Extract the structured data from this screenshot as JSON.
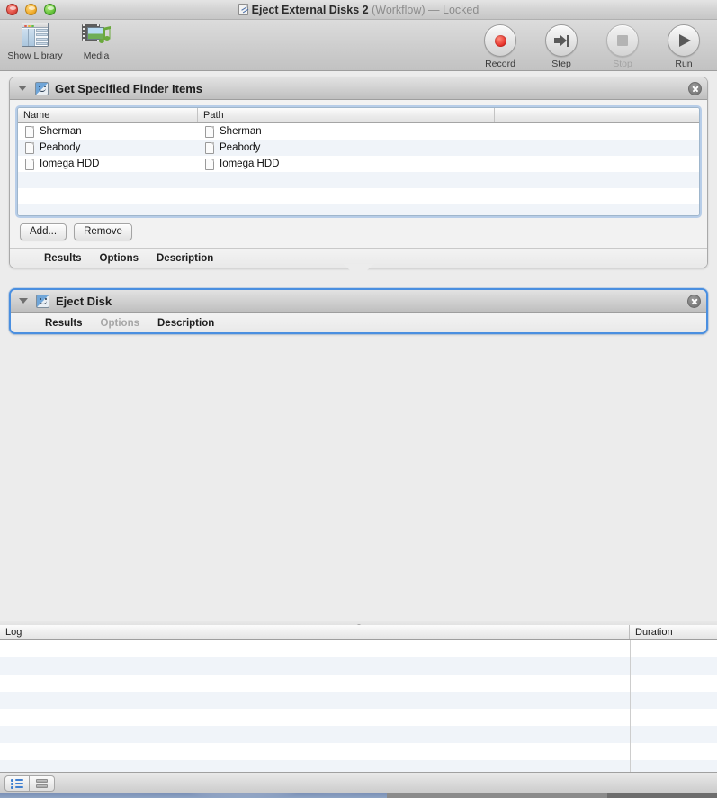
{
  "window": {
    "title_name": "Eject External Disks 2",
    "title_suffix": "(Workflow) — Locked",
    "traffic_lights": [
      "close-button",
      "minimize-button",
      "zoom-button"
    ]
  },
  "toolbar": {
    "left_items": [
      {
        "label": "Show Library",
        "icon": "library-icon",
        "enabled": true
      },
      {
        "label": "Media",
        "icon": "media-icon",
        "enabled": true
      }
    ],
    "right_items": [
      {
        "label": "Record",
        "icon": "record-icon",
        "enabled": true
      },
      {
        "label": "Step",
        "icon": "step-icon",
        "enabled": true
      },
      {
        "label": "Stop",
        "icon": "stop-icon",
        "enabled": false
      },
      {
        "label": "Run",
        "icon": "run-icon",
        "enabled": true
      }
    ]
  },
  "workflow": {
    "actions": [
      {
        "title": "Get Specified Finder Items",
        "icon": "finder-icon",
        "selected": false,
        "table": {
          "columns": [
            "Name",
            "Path"
          ],
          "rows": [
            {
              "name": "Sherman",
              "path": "Sherman"
            },
            {
              "name": "Peabody",
              "path": "Peabody"
            },
            {
              "name": "Iomega HDD",
              "path": "Iomega HDD"
            }
          ]
        },
        "buttons": [
          {
            "label": "Add...",
            "name": "add-button"
          },
          {
            "label": "Remove",
            "name": "remove-button"
          }
        ],
        "footer_tabs": [
          {
            "label": "Results",
            "enabled": true
          },
          {
            "label": "Options",
            "enabled": true
          },
          {
            "label": "Description",
            "enabled": true
          }
        ]
      },
      {
        "title": "Eject Disk",
        "icon": "finder-icon",
        "selected": true,
        "footer_tabs": [
          {
            "label": "Results",
            "enabled": true
          },
          {
            "label": "Options",
            "enabled": false
          },
          {
            "label": "Description",
            "enabled": true
          }
        ]
      }
    ]
  },
  "log": {
    "columns": [
      "Log",
      "Duration"
    ],
    "rows": []
  },
  "status_bar": {
    "view_buttons": [
      {
        "name": "log-list-view-button",
        "icon": "list-view-icon",
        "active": true
      },
      {
        "name": "split-view-button",
        "icon": "split-view-icon",
        "active": false
      }
    ]
  },
  "colors": {
    "selection_blue": "#4a8fe0",
    "record_red": "#e8312a",
    "canvas_gray": "#ececec",
    "row_stripe": "#f0f4f9"
  }
}
